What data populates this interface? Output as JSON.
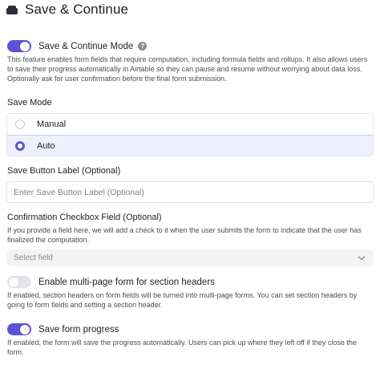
{
  "header": {
    "title": "Save & Continue",
    "icon": "archive-box-icon"
  },
  "save_continue": {
    "label": "Save & Continue Mode",
    "enabled": true,
    "help": "?",
    "description": "This feature enables form fields that require computation, including formula fields and rollups. It also allows users to save their progress automatically in Airtable so they can pause and resume without worrying about data loss. Optionally ask for user confirmation before the final form submission."
  },
  "save_mode": {
    "label": "Save Mode",
    "options": [
      {
        "label": "Manual",
        "selected": false
      },
      {
        "label": "Auto",
        "selected": true
      }
    ]
  },
  "save_button_label": {
    "label": "Save Button Label (Optional)",
    "placeholder": "Enter Save Button Label (Optional)",
    "value": ""
  },
  "confirmation": {
    "label": "Confirmation Checkbox Field (Optional)",
    "description": "If you provide a field here, we will add a check to it when the user submits the form to indicate that the user has finalized the computation.",
    "select_placeholder": "Select field"
  },
  "multipage": {
    "label": "Enable multi-page form for section headers",
    "enabled": false,
    "description": "If enabled, section headers on form fields will be turned into multi-page forms. You can set section headers by going to form fields and setting a section header."
  },
  "save_progress": {
    "label": "Save form progress",
    "enabled": true,
    "description": "If enabled, the form will save the progress automatically. Users can pick up where they left off if they close the form."
  },
  "colors": {
    "accent": "#5b53d6",
    "selected_bg": "#eef0fd",
    "toggle_off": "#e3e4e8"
  }
}
